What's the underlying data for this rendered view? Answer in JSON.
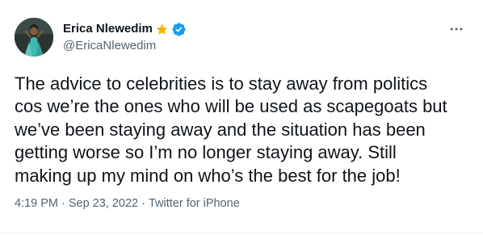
{
  "author": {
    "display_name": "Erica Nlewedim",
    "handle": "@EricaNlewedim",
    "name_emoji_icon": "star-icon",
    "verified_icon": "verified-badge-icon",
    "avatar_icon": "profile-photo"
  },
  "tweet": {
    "lines": [
      "The advice to celebrities is to stay away from politics",
      "cos we’re the ones who will be used as scapegoats but",
      "we’ve been staying away and the situation has been",
      "getting worse so I’m no longer staying away. Still",
      "making up my mind on who’s the best for the job!"
    ],
    "time": "4:19 PM",
    "separator": "·",
    "date": "Sep 23, 2022",
    "source": "Twitter for iPhone"
  },
  "menu": {
    "icon": "more-horizontal-icon"
  },
  "colors": {
    "text_primary": "#0f1419",
    "text_secondary": "#536471",
    "verified_blue": "#1d9bf0",
    "star_gold": "#f4b400"
  }
}
